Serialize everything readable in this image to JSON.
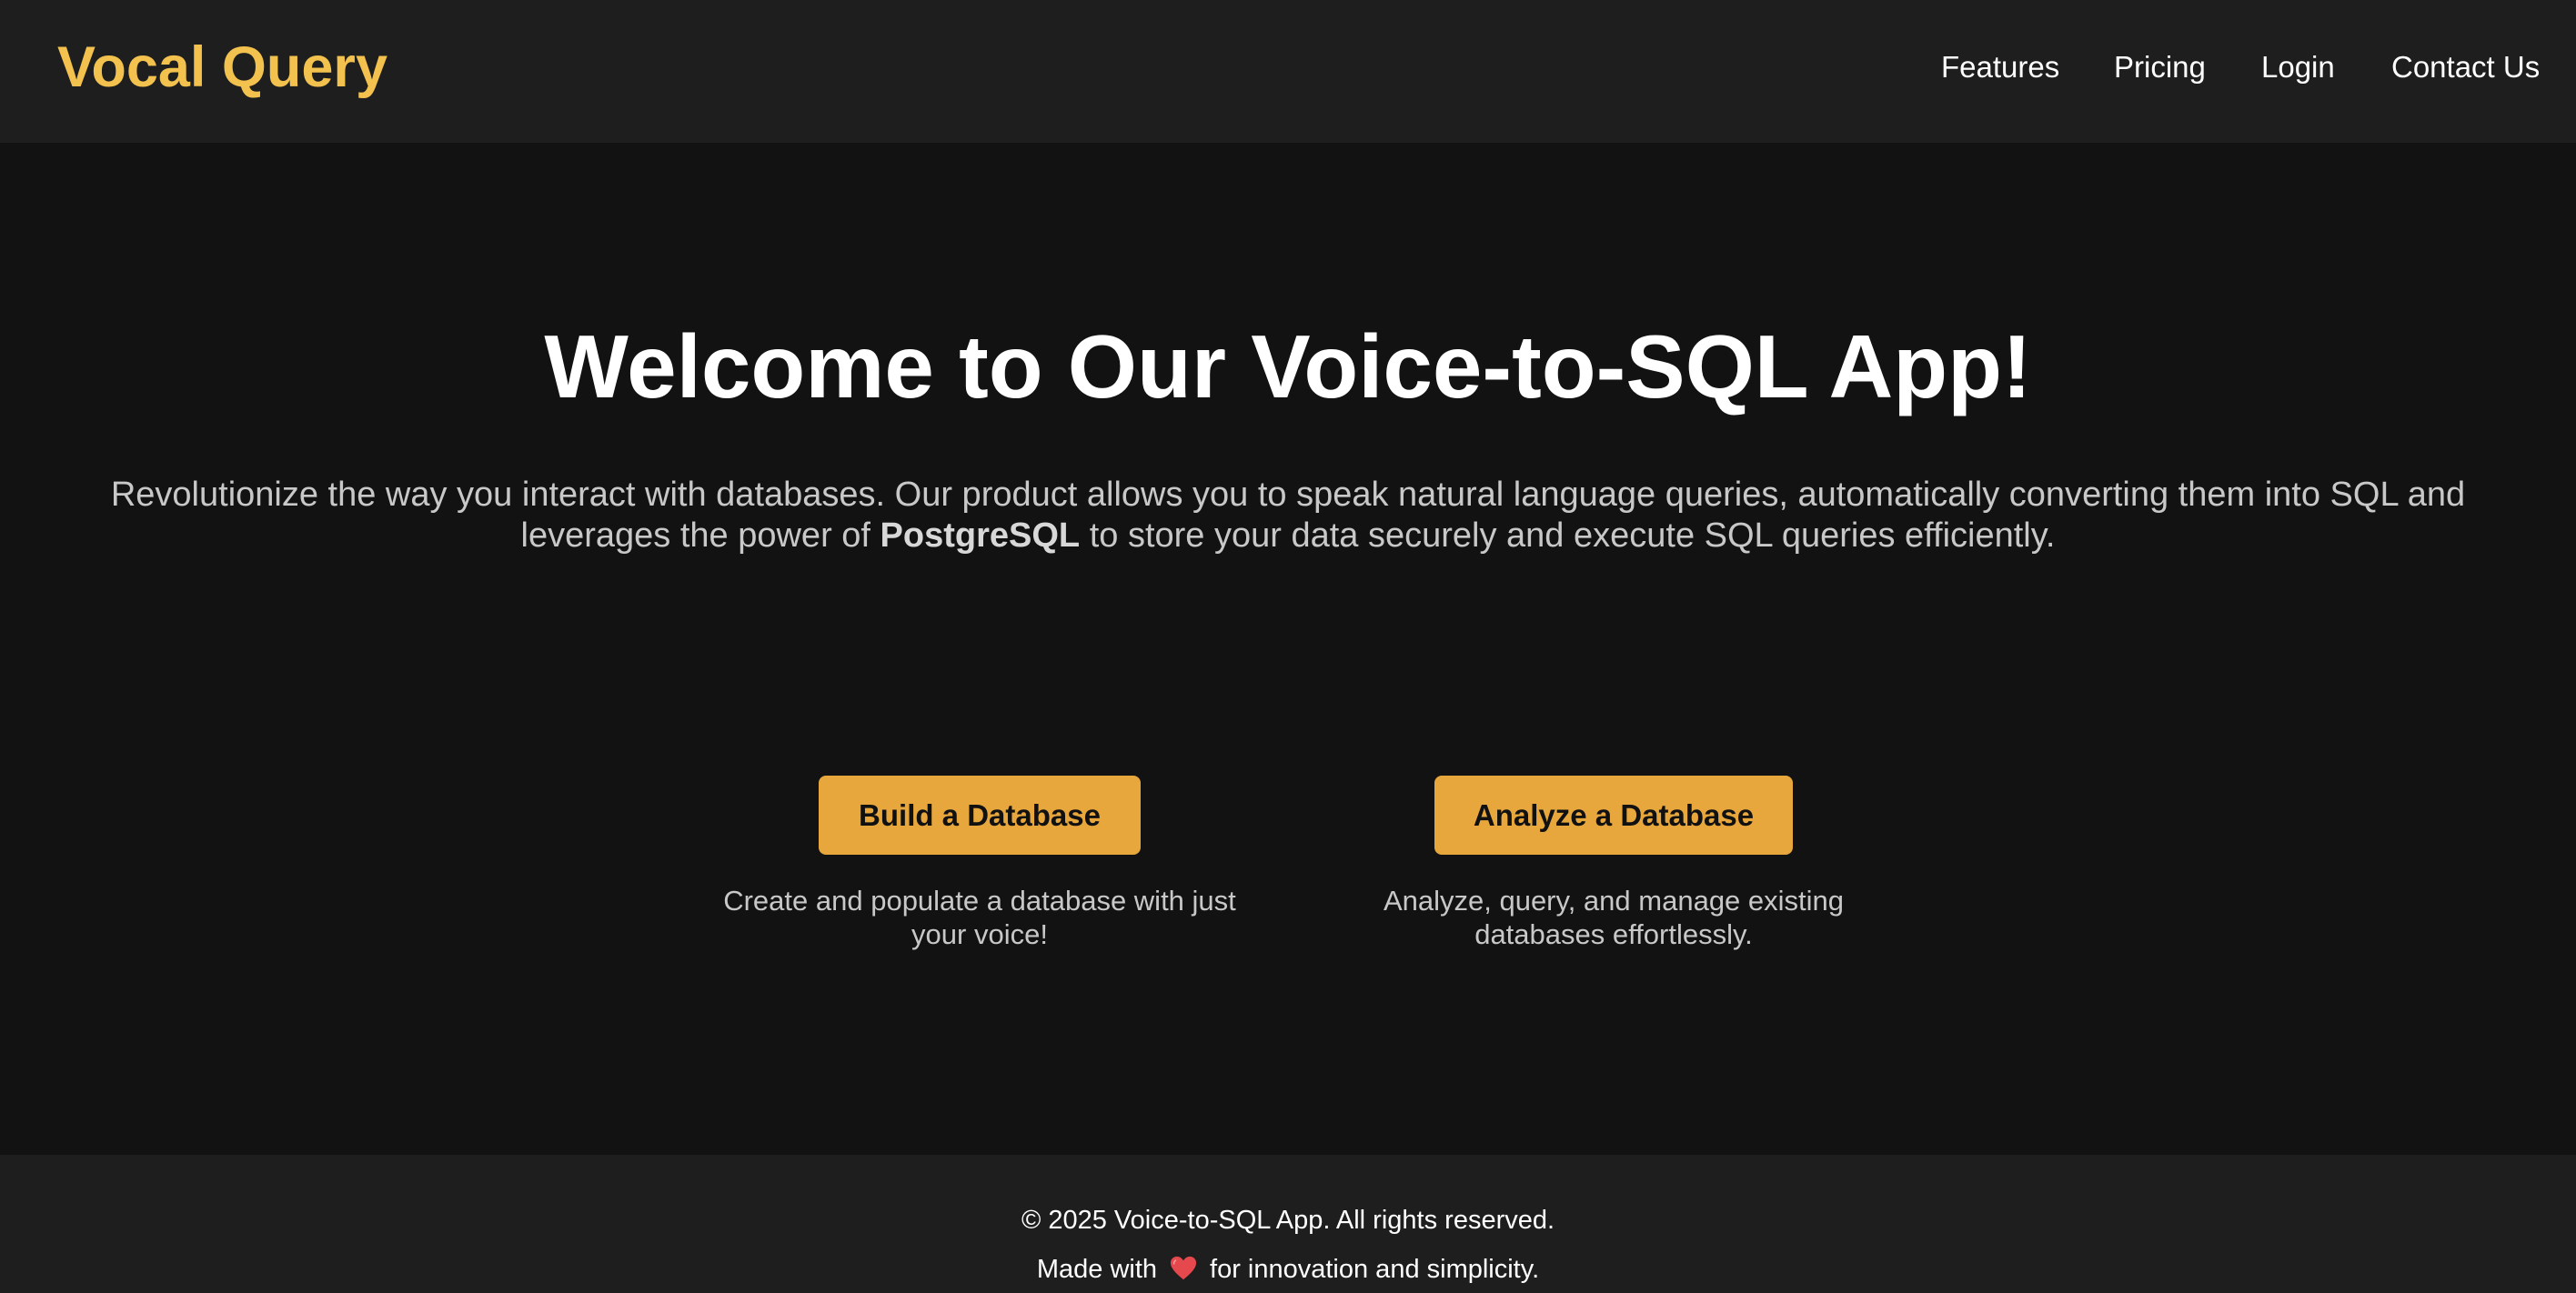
{
  "header": {
    "brand": "Vocal Query",
    "nav": {
      "features": "Features",
      "pricing": "Pricing",
      "login": "Login",
      "contact": "Contact Us"
    }
  },
  "hero": {
    "title": "Welcome to Our Voice-to-SQL App!",
    "desc_before": "Revolutionize the way you interact with databases. Our product allows you to speak natural language queries, automatically converting them into SQL and leverages the power of ",
    "desc_bold": "PostgreSQL",
    "desc_after": " to store your data securely and execute SQL queries efficiently."
  },
  "actions": {
    "build": {
      "label": "Build a Database",
      "caption": "Create and populate a database with just your voice!"
    },
    "analyze": {
      "label": "Analyze a Database",
      "caption": "Analyze, query, and manage existing databases effortlessly."
    }
  },
  "footer": {
    "copyright": "© 2025 Voice-to-SQL App. All rights reserved.",
    "made_before": "Made with",
    "made_icon": "heart-icon",
    "made_after": "for innovation and simplicity."
  },
  "colors": {
    "brand": "#f2c14e",
    "button": "#e8a73c",
    "background": "#121212",
    "bar": "#1e1e1e",
    "heart": "#e5484d"
  }
}
